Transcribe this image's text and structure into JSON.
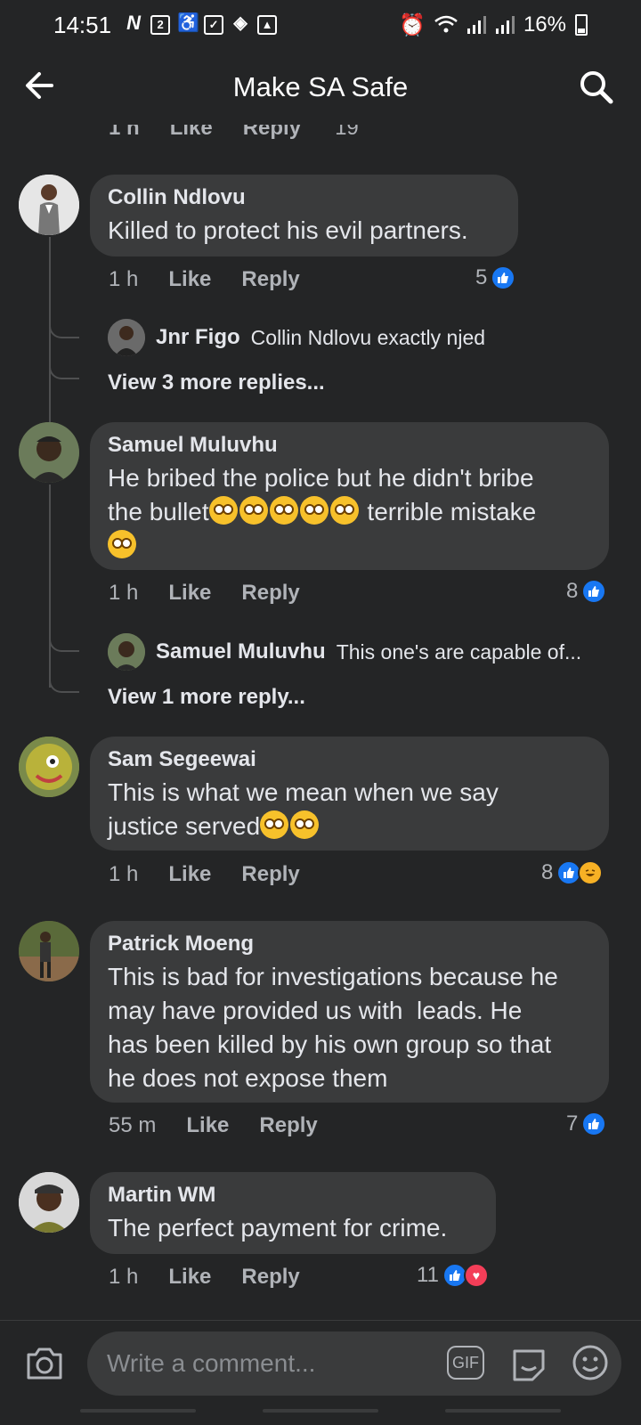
{
  "status": {
    "time": "14:51",
    "battery": "16%"
  },
  "header": {
    "title": "Make SA Safe"
  },
  "partial": {
    "time": "1 h",
    "like": "Like",
    "reply": "Reply",
    "count": "19"
  },
  "comments": [
    {
      "name": "Collin Ndlovu",
      "text": "Killed to protect his evil partners.",
      "time": "1 h",
      "like": "Like",
      "reply": "Reply",
      "reactions_count": "5",
      "reply_preview": {
        "name": "Jnr Figo",
        "text": "Collin Ndlovu exactly njed"
      },
      "view_more": "View 3 more replies..."
    },
    {
      "name": "Samuel Muluvhu",
      "text_line1": "He bribed the police but he didn't bribe",
      "text_line2_a": "the bullet",
      "text_line2_b": " terrible mistake",
      "time": "1 h",
      "like": "Like",
      "reply": "Reply",
      "reactions_count": "8",
      "reply_preview": {
        "name": "Samuel Muluvhu",
        "text": "This one's are capable of..."
      },
      "view_more": "View 1 more reply..."
    },
    {
      "name": "Sam Segeewai",
      "text_line1": "This is what we mean when we say",
      "text_line2": "justice served",
      "time": "1 h",
      "like": "Like",
      "reply": "Reply",
      "reactions_count": "8"
    },
    {
      "name": "Patrick Moeng",
      "text_lines": [
        "This is bad for investigations because he",
        "may have provided us with  leads. He",
        "has been killed by his own group so that",
        "he does not expose them"
      ],
      "time": "55 m",
      "like": "Like",
      "reply": "Reply",
      "reactions_count": "7"
    },
    {
      "name": "Martin WM",
      "text": "The perfect payment for crime.",
      "time": "1 h",
      "like": "Like",
      "reply": "Reply",
      "reactions_count": "11"
    }
  ],
  "composer": {
    "placeholder": "Write a comment...",
    "gif_label": "GIF"
  },
  "icons": {
    "back": "arrow-left-icon",
    "search": "search-icon",
    "camera": "camera-icon",
    "sticker": "sticker-icon",
    "emoji": "smiley-icon",
    "like": "thumbs-up-icon",
    "haha": "laughing-face-icon",
    "love": "heart-icon"
  },
  "colors": {
    "background": "#242526",
    "bubble": "#3a3b3c",
    "like_blue": "#1877f2",
    "love_red": "#f33e58",
    "haha_yellow": "#f7b125"
  }
}
